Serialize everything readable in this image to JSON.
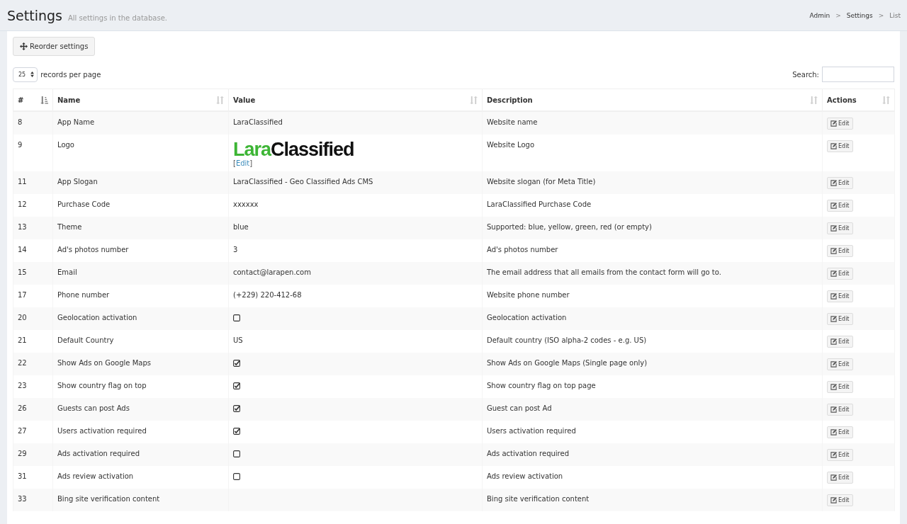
{
  "header": {
    "title": "Settings",
    "subtitle": "All settings in the database.",
    "breadcrumb": [
      {
        "label": "Admin",
        "current": false
      },
      {
        "separator": ">",
        "label": "Settings",
        "current": false
      },
      {
        "separator": ">",
        "label": "List",
        "current": true
      }
    ]
  },
  "toolbar": {
    "reorder_button": "Reorder settings"
  },
  "length": {
    "value": "25",
    "label": "records per page"
  },
  "search": {
    "label": "Search:"
  },
  "table": {
    "columns": [
      {
        "label": "#",
        "sorted": true
      },
      {
        "label": "Name",
        "sorted": false
      },
      {
        "label": "Value",
        "sorted": false
      },
      {
        "label": "Description",
        "sorted": false
      },
      {
        "label": "Actions",
        "sorted": false
      }
    ],
    "rows": [
      {
        "id": "8",
        "name": "App Name",
        "kind": "text",
        "value": "LaraClassified",
        "description": "Website name",
        "action": "Edit"
      },
      {
        "id": "9",
        "name": "Logo",
        "kind": "logo",
        "logo": {
          "part_1": "Lara",
          "part_2": "Classified"
        },
        "edit_link": {
          "open": "[",
          "label": "Edit",
          "close": "]"
        },
        "description": "Website Logo",
        "action": "Edit"
      },
      {
        "id": "11",
        "name": "App Slogan",
        "kind": "text",
        "value": "LaraClassified - Geo Classified Ads CMS",
        "description": "Website slogan (for Meta Title)",
        "action": "Edit"
      },
      {
        "id": "12",
        "name": "Purchase Code",
        "kind": "text",
        "value": "xxxxxx",
        "description": "LaraClassified Purchase Code",
        "action": "Edit"
      },
      {
        "id": "13",
        "name": "Theme",
        "kind": "text",
        "value": "blue",
        "description": "Supported: blue, yellow, green, red (or empty)",
        "action": "Edit"
      },
      {
        "id": "14",
        "name": "Ad's photos number",
        "kind": "text",
        "value": "3",
        "description": "Ad's photos number",
        "action": "Edit"
      },
      {
        "id": "15",
        "name": "Email",
        "kind": "text",
        "value": "contact@larapen.com",
        "description": "The email address that all emails from the contact form will go to.",
        "action": "Edit"
      },
      {
        "id": "17",
        "name": "Phone number",
        "kind": "text",
        "value": "(+229) 220-412-68",
        "description": "Website phone number",
        "action": "Edit"
      },
      {
        "id": "20",
        "name": "Geolocation activation",
        "kind": "checkbox",
        "checked": false,
        "description": "Geolocation activation",
        "action": "Edit"
      },
      {
        "id": "21",
        "name": "Default Country",
        "kind": "text",
        "value": "US",
        "description": "Default country (ISO alpha-2 codes - e.g. US)",
        "action": "Edit"
      },
      {
        "id": "22",
        "name": "Show Ads on Google Maps",
        "kind": "checkbox",
        "checked": true,
        "description": "Show Ads on Google Maps (Single page only)",
        "action": "Edit"
      },
      {
        "id": "23",
        "name": "Show country flag on top",
        "kind": "checkbox",
        "checked": true,
        "description": "Show country flag on top page",
        "action": "Edit"
      },
      {
        "id": "26",
        "name": "Guests can post Ads",
        "kind": "checkbox",
        "checked": true,
        "description": "Guest can post Ad",
        "action": "Edit"
      },
      {
        "id": "27",
        "name": "Users activation required",
        "kind": "checkbox",
        "checked": true,
        "description": "Users activation required",
        "action": "Edit"
      },
      {
        "id": "29",
        "name": "Ads activation required",
        "kind": "checkbox",
        "checked": false,
        "description": "Ads activation required",
        "action": "Edit"
      },
      {
        "id": "31",
        "name": "Ads review activation",
        "kind": "checkbox",
        "checked": false,
        "description": "Ads review activation",
        "action": "Edit"
      },
      {
        "id": "33",
        "name": "Bing site verification content",
        "kind": "empty",
        "description": "Bing site verification content",
        "action": "Edit"
      }
    ]
  }
}
